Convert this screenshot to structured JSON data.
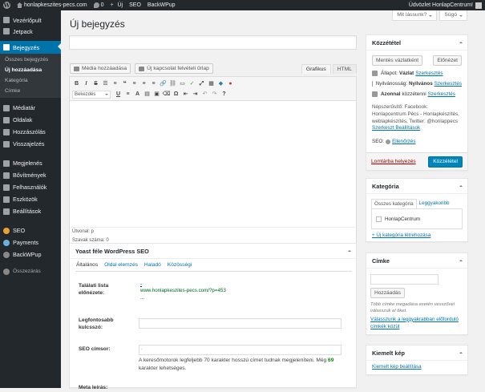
{
  "adminbar": {
    "site_name": "honlapkeszites-pecs.com",
    "comments_count": "0",
    "new_label": "Új",
    "seo_label": "SEO",
    "backwpup_label": "BackWPup",
    "greeting": "Üdvözlet HonlapCentrum!"
  },
  "screen_options": {
    "label": "Mit lássunk?"
  },
  "help": {
    "label": "Súgó"
  },
  "sidebar": {
    "items": [
      {
        "label": "Vezérlőpult",
        "icon": "dashboard-icon"
      },
      {
        "label": "Jetpack",
        "icon": "jetpack-icon"
      },
      {
        "label": "Bejegyzés",
        "icon": "pin-icon"
      },
      {
        "label": "Médiatár",
        "icon": "media-icon"
      },
      {
        "label": "Oldalak",
        "icon": "pages-icon"
      },
      {
        "label": "Hozzászólás",
        "icon": "comments-icon"
      },
      {
        "label": "Visszajelzés",
        "icon": "feedback-icon"
      },
      {
        "label": "Megjelenés",
        "icon": "appearance-icon"
      },
      {
        "label": "Bővítmények",
        "icon": "plugins-icon"
      },
      {
        "label": "Felhasználók",
        "icon": "users-icon"
      },
      {
        "label": "Eszközök",
        "icon": "tools-icon"
      },
      {
        "label": "Beállítások",
        "icon": "settings-icon"
      },
      {
        "label": "SEO",
        "icon": "seo-icon"
      },
      {
        "label": "Payments",
        "icon": "payments-icon"
      },
      {
        "label": "BackWPup",
        "icon": "backwpup-icon"
      },
      {
        "label": "Összezárás",
        "icon": "collapse-icon"
      }
    ],
    "submenu": [
      "Összes bejegyzés",
      "Új hozzáadása",
      "Kategória",
      "Címke"
    ]
  },
  "page": {
    "title": "Új bejegyzés",
    "post_title_value": ""
  },
  "media": {
    "add_media": "Média hozzáadása",
    "contact_form": "Új kapcsolat felvételi űrlap"
  },
  "editor": {
    "tab_visual": "Grafikus",
    "tab_html": "HTML",
    "format_select": "Bekezdés",
    "path": "Útvonal: p",
    "word_count": "Szavak száma: 0",
    "content": ""
  },
  "yoast": {
    "title": "Yoast féle WordPress SEO",
    "tabs": [
      "Általános",
      "Oldal elemzés",
      "Haladó",
      "Közösségi"
    ],
    "snippet_label": "Találati lista előnézete:",
    "snippet_title": "-",
    "snippet_url": "www.honlapkeszites-pecs.com/?p=453",
    "snippet_desc": "...",
    "focus_label": "Legfontosabb kulcsszó:",
    "focus_value": "",
    "title_label": "SEO címsor:",
    "title_value": "-",
    "desc_before": "A keresőmotorok legfeljebb 70 karakter hosszú címet tudnak megjeleníteni. Még ",
    "desc_count": "69",
    "desc_after": " karakter lehetséges.",
    "meta_label": "Meta leírás:"
  },
  "publish": {
    "title": "Közzététel",
    "save_draft": "Mentés vázlatként",
    "preview": "Előnézet",
    "status_label": "Állapot:",
    "status_value": "Vázlat",
    "edit": "Szerkesztés",
    "visibility_label": "Nyilvánosság:",
    "visibility_value": "Nyilvános",
    "publish_label": "Azonnal",
    "publish_suffix": "közzétenni",
    "share_text": "Népszerűsítő: Facebook: Honlapcentrum Pécs - Honlapkészítés, weblapkészítés, Twitter: @honlappecs",
    "share_settings": "Szerkeszt Beállítások",
    "seo_label": "SEO:",
    "seo_check": "Ellenőrzés",
    "trash": "Lomtárba helyezés",
    "publish_button": "Közzététel"
  },
  "category": {
    "title": "Kategória",
    "tab_all": "Összes kategória",
    "tab_popular": "Leggyakoribb",
    "items": [
      "HonlapCentrum"
    ],
    "add_new": "+ Új kategória létrehozása"
  },
  "tags": {
    "title": "Címke",
    "add_button": "Hozzáadás",
    "note": "Több címke megadása esetén vesszővel válasszuk el őket.",
    "popular_link": "Válasszunk a leggyakrabban előforduló címkék közül"
  },
  "featured": {
    "title": "Kiemelt kép",
    "set_link": "Kiemelt kép beállítása"
  },
  "colors": {
    "accent": "#0073aa",
    "adminbar": "#23282d",
    "publish": "#0085ba",
    "trash": "#aa0000"
  }
}
